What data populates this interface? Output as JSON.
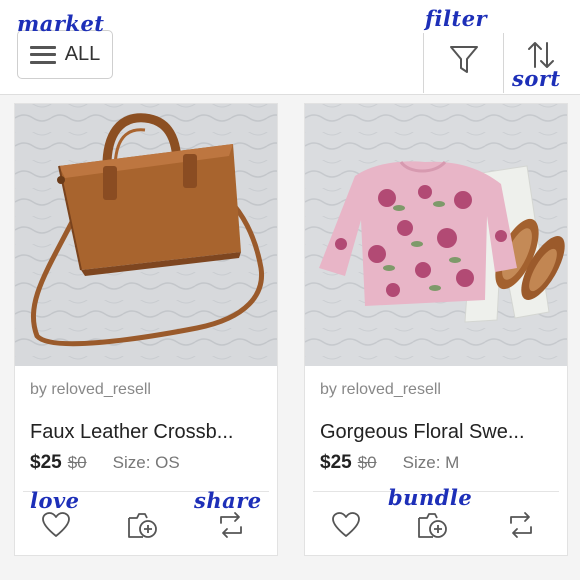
{
  "annotations": {
    "market": "market",
    "filter": "filter",
    "sort": "sort",
    "love": "love",
    "share": "share",
    "bundle": "bundle"
  },
  "toolbar": {
    "market_label": "ALL",
    "menu_icon": "hamburger-icon",
    "filter_icon": "funnel-icon",
    "sort_icon": "up-down-arrows-icon"
  },
  "listings": [
    {
      "seller": "by reloved_resell",
      "title": "Faux Leather Crossb...",
      "price": "$25",
      "original_price": "$0",
      "size": "Size: OS",
      "image": "brown-crossbody-bag-photo"
    },
    {
      "seller": "by reloved_resell",
      "title": "Gorgeous Floral Swe...",
      "price": "$25",
      "original_price": "$0",
      "size": "Size: M",
      "image": "pink-floral-sweater-outfit-photo"
    }
  ],
  "action_icons": [
    "heart-icon",
    "bundle-add-icon",
    "share-repost-icon"
  ],
  "colors": {
    "annotation_ink": "#1d2fb8",
    "background": "#f4f4f4",
    "card": "#ffffff"
  }
}
